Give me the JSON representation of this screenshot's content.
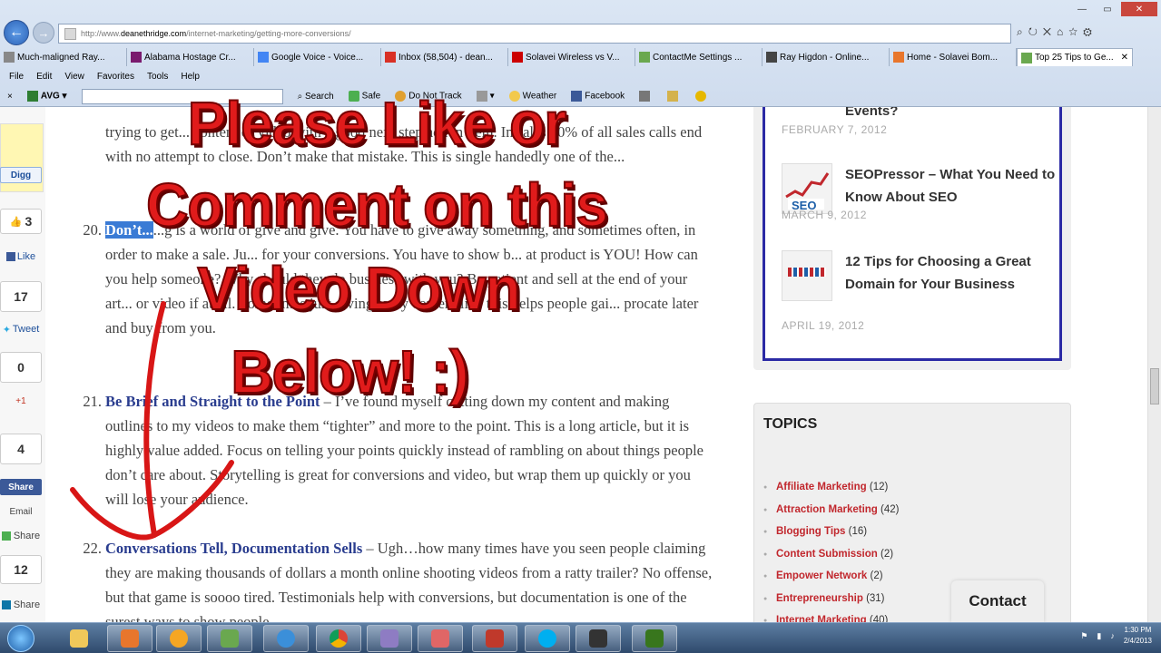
{
  "browser": {
    "url_prefix": "http://www.",
    "url_domain": "deanethridge.com",
    "url_path": "/internet-marketing/getting-more-conversions/",
    "tabs": [
      {
        "label": "Much-maligned Ray...",
        "active": false
      },
      {
        "label": "Alabama Hostage Cr...",
        "active": false
      },
      {
        "label": "Google Voice - Voice...",
        "active": false
      },
      {
        "label": "Inbox (58,504) - dean...",
        "active": false
      },
      {
        "label": "Solavei Wireless vs V...",
        "active": false
      },
      {
        "label": "ContactMe Settings ...",
        "active": false
      },
      {
        "label": "Ray Higdon - Online...",
        "active": false
      },
      {
        "label": "Home - Solavei Bom...",
        "active": false
      },
      {
        "label": "Top 25 Tips to Ge...",
        "active": true
      }
    ],
    "menu": [
      "File",
      "Edit",
      "View",
      "Favorites",
      "Tools",
      "Help"
    ],
    "toolbar": {
      "close": "×",
      "avg": "AVG",
      "search": "Search",
      "safe": "Safe",
      "dnt": "Do Not Track",
      "weather": "Weather",
      "facebook": "Facebook"
    }
  },
  "sharebar": {
    "digg": "Digg",
    "fb_count": "3",
    "like": "Like",
    "tweet_count": "17",
    "tweet": "Tweet",
    "plus_count": "0",
    "plus": "+1",
    "share_count": "4",
    "share": "Share",
    "email": "Email",
    "share2": "Share",
    "li_count": "12",
    "li_share": "Share"
  },
  "article": {
    "items": [
      {
        "num": "",
        "text": "trying to get... content or video with a good next step action item. In sales 80% of all sales calls end with no attempt to close. Don’t make that mistake. This is single handedly one of the..."
      },
      {
        "num": "20.",
        "head": "Don’t...",
        "text": "...g is a world of give and give. You have to give away something, and sometimes often, in order to make a sale. Ju... for your conversions. You have to show b... at product is YOU! How can you help someone? Why should they do business with you? Be patient and sell at the end of your art... or video if at all. Sometimes just giving away content like this helps people gai... procate later and buy from you."
      },
      {
        "num": "21.",
        "head": "Be Brief and Straight to the Point",
        "text": " – I’ve found myself cutting down my content and making outlines to my videos to make them “tighter” and more to the point. This is a long article, but it is highly value added. Focus on telling your points quickly instead of rambling on about things people don’t care about. Storytelling is great for conversions and video, but wrap them up quickly or you will lose your audience."
      },
      {
        "num": "22.",
        "head": "Conversations Tell, Documentation Sells",
        "text": " – Ugh…how many times have you seen people claiming they are making thousands of dollars a month online shooting videos from a ratty trailer? No offense, but that game is soooo tired. Testimonials help with conversions, but documentation is one of the surest ways to show people"
      }
    ]
  },
  "sidebar": {
    "posts": [
      {
        "title": "Events?",
        "date": "FEBRUARY 7, 2012"
      },
      {
        "title": "SEOPressor – What You Need to Know About SEO",
        "date": "MARCH 9, 2012",
        "thumb": "SEO"
      },
      {
        "title": "12 Tips for Choosing a Great Domain for Your Business",
        "date": "APRIL 19, 2012"
      }
    ],
    "topics_title": "TOPICS",
    "topics": [
      {
        "name": "Affiliate Marketing",
        "count": "(12)"
      },
      {
        "name": "Attraction Marketing",
        "count": "(42)"
      },
      {
        "name": "Blogging Tips",
        "count": "(16)"
      },
      {
        "name": "Content Submission",
        "count": "(2)"
      },
      {
        "name": "Empower Network",
        "count": "(2)"
      },
      {
        "name": "Entrepreneurship",
        "count": "(31)"
      },
      {
        "name": "Internet Marketing",
        "count": "(40)"
      }
    ],
    "contact": "Contact"
  },
  "overlay": {
    "line1": "Please Like or",
    "line2": "Comment on this",
    "line3": "Video Down",
    "line4": "Below! :)"
  },
  "taskbar": {
    "time": "1:30 PM",
    "date": "2/4/2013"
  },
  "colors": {
    "overlay_text": "#e01b1b",
    "link": "#2a3d8f",
    "topic": "#c1272d",
    "sidebar_border": "#2b2aa5"
  }
}
